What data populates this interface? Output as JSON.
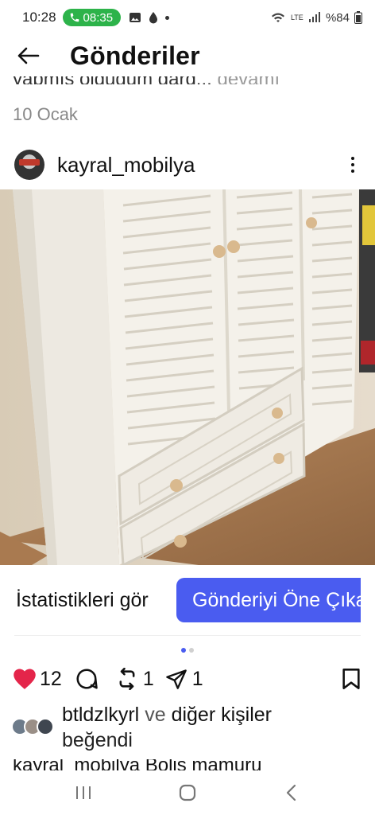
{
  "status_bar": {
    "time": "10:28",
    "call_time": "08:35",
    "battery": "%84",
    "network": "LTE"
  },
  "header": {
    "title": "Gönderiler"
  },
  "previous_post": {
    "caption_fragment": "yapmış olduğum gard...",
    "more_label": "devamı",
    "date": "10 Ocak"
  },
  "post": {
    "username": "kayral_mobilya",
    "photo_description_icon": "wardrobe-photo",
    "stats_label": "İstatistikleri gör",
    "boost_label": "Gönderiyi Öne Çıkar",
    "carousel_count": 2,
    "carousel_active_index": 0,
    "likes_count": "12",
    "comments_icon": "comment-icon",
    "reposts_count": "1",
    "shares_count": "1",
    "liked_by_user": "btldzlkyrl",
    "liked_by_connector": "ve",
    "liked_by_rest": "diğer kişiler",
    "liked_by_suffix": "beğendi",
    "caption_preview": "kayral_mobilya Bolis mamuru"
  },
  "colors": {
    "accent": "#4a5cf0",
    "like_red": "#e4254a",
    "call_green": "#2db34a"
  }
}
